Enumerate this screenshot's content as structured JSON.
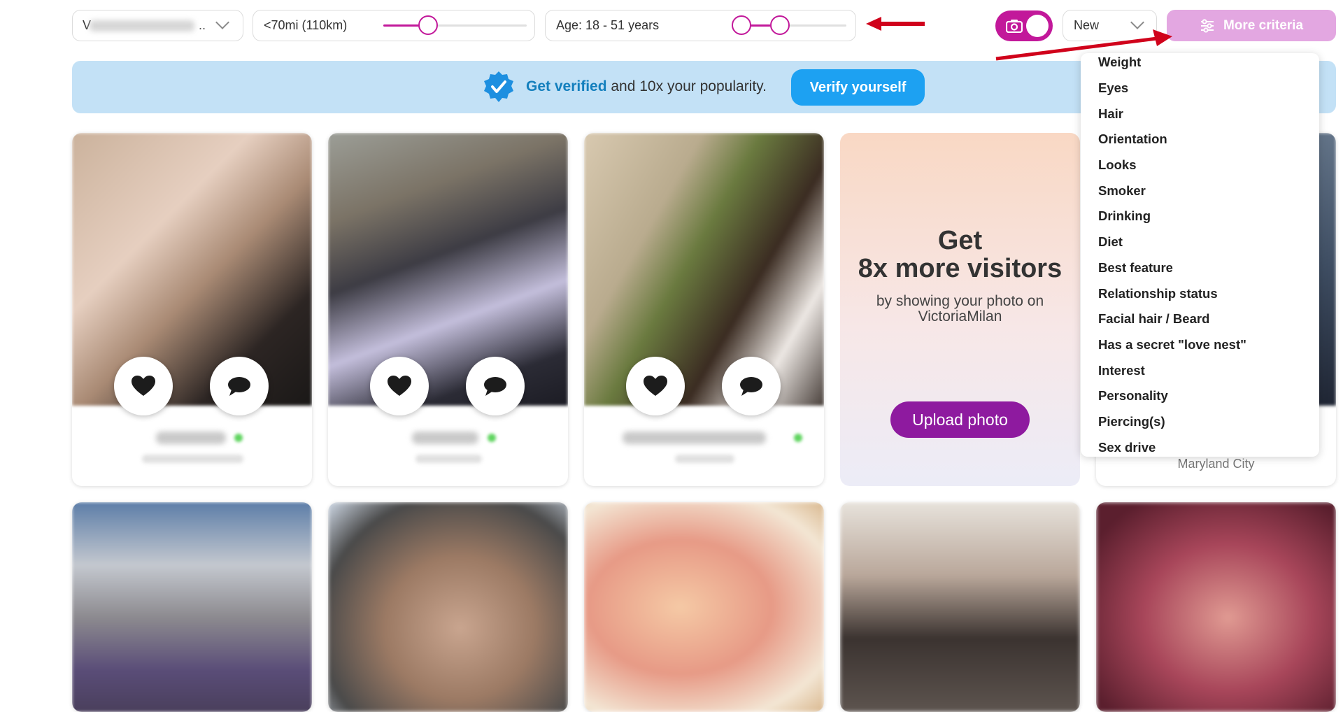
{
  "filters": {
    "location_value": "V",
    "location_suffix": "..",
    "distance_label": "<70mi (110km)",
    "distance_fraction": 0.31,
    "age_label": "Age: 18 - 51 years",
    "age_range_fraction": [
      0.0,
      0.36
    ],
    "photo_toggle_on": true,
    "sort_value": "New",
    "more_criteria_label": "More criteria"
  },
  "colors": {
    "accent": "#c2189a",
    "more_criteria_bg": "#e3a7e1",
    "banner_bg": "#c3e1f6",
    "verify_btn": "#1da1f2",
    "upload_btn": "#8e1a9f",
    "annotation_arrow": "#d0021b"
  },
  "banner": {
    "strong": "Get verified",
    "rest": " and 10x your popularity.",
    "button_label": "Verify yourself"
  },
  "promo": {
    "line1": "Get",
    "line2": "8x more visitors",
    "line3": "by showing your photo on",
    "line4": "VictoriaMilan",
    "button_label": "Upload photo"
  },
  "partial_card_city": "Maryland City",
  "more_criteria_menu": [
    "Weight",
    "Eyes",
    "Hair",
    "Orientation",
    "Looks",
    "Smoker",
    "Drinking",
    "Diet",
    "Best feature",
    "Relationship status",
    "Facial hair / Beard",
    "Has a secret \"love nest\"",
    "Interest",
    "Personality",
    "Piercing(s)",
    "Sex drive"
  ]
}
